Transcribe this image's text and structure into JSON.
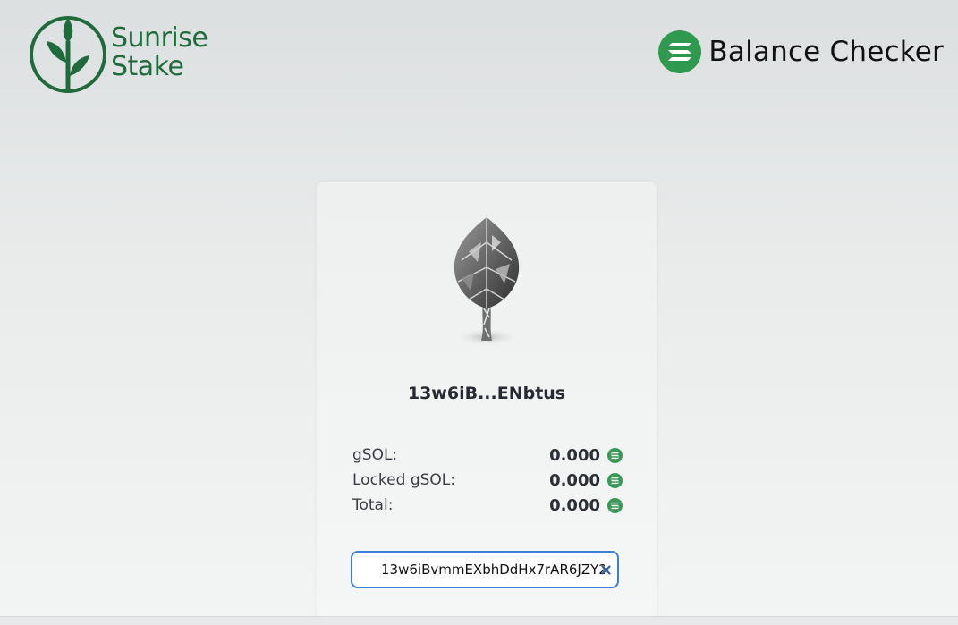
{
  "brand": {
    "line1": "Sunrise",
    "line2": "Stake",
    "color": "#1f6b3c"
  },
  "header": {
    "app_title": "Balance Checker",
    "badge_color": "#2f9a4f",
    "badge_icon": "solana-icon"
  },
  "card": {
    "art": "tree-art",
    "address_short": "13w6iB...ENbtus",
    "balances": [
      {
        "label": "gSOL:",
        "value": "0.000",
        "icon": "solana-token-icon"
      },
      {
        "label": "Locked gSOL:",
        "value": "0.000",
        "icon": "solana-token-icon"
      },
      {
        "label": "Total:",
        "value": "0.000",
        "icon": "solana-token-icon"
      }
    ],
    "address_input": {
      "value": "13w6iBvmmEXbhDdHx7rAR6JZY2",
      "clear_icon": "close-icon",
      "border_color": "#3f7fd6"
    }
  }
}
